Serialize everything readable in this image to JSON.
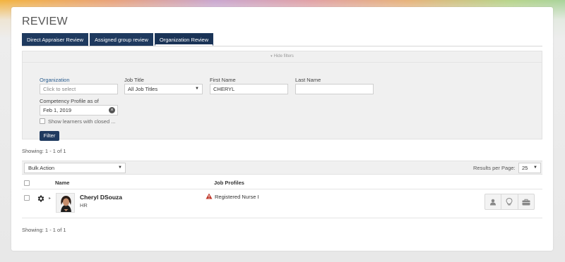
{
  "page": {
    "title": "REVIEW"
  },
  "tabs": [
    {
      "label": "Direct Appraiser Review",
      "active": false
    },
    {
      "label": "Assigned group review",
      "active": false
    },
    {
      "label": "Organization Review",
      "active": true
    }
  ],
  "filters": {
    "toggle_label": "Hide filters",
    "organization": {
      "label": "Organization",
      "placeholder": "Click to select"
    },
    "job_title": {
      "label": "Job Title",
      "value": "All Job Titles"
    },
    "first_name": {
      "label": "First Name",
      "value": "CHERYL"
    },
    "last_name": {
      "label": "Last Name",
      "value": ""
    },
    "competency_profile": {
      "label": "Competency Profile as of",
      "value": "Feb 1, 2019"
    },
    "show_closed": {
      "label": "Show learners with closed ...",
      "checked": false
    },
    "filter_button": "Filter"
  },
  "showing_top": "Showing: 1 - 1 of 1",
  "toolbar": {
    "bulk_action": "Bulk Action",
    "results_per_page_label": "Results per Page:",
    "results_per_page_value": "25"
  },
  "table": {
    "headers": {
      "name": "Name",
      "job_profiles": "Job Profiles"
    },
    "rows": [
      {
        "name": "Cheryl DSouza",
        "dept": "HR",
        "job_profile": "Registered Nurse I",
        "warning": true
      }
    ]
  },
  "showing_bottom": "Showing: 1 - 1 of 1",
  "icons": {
    "gear": "gear-icon",
    "warning": "warning-icon",
    "person": "person-icon",
    "lightbulb": "lightbulb-icon",
    "briefcase": "briefcase-icon"
  },
  "colors": {
    "primary": "#1f3a5f",
    "warning": "#c0392b",
    "link": "#2a5d8f"
  }
}
